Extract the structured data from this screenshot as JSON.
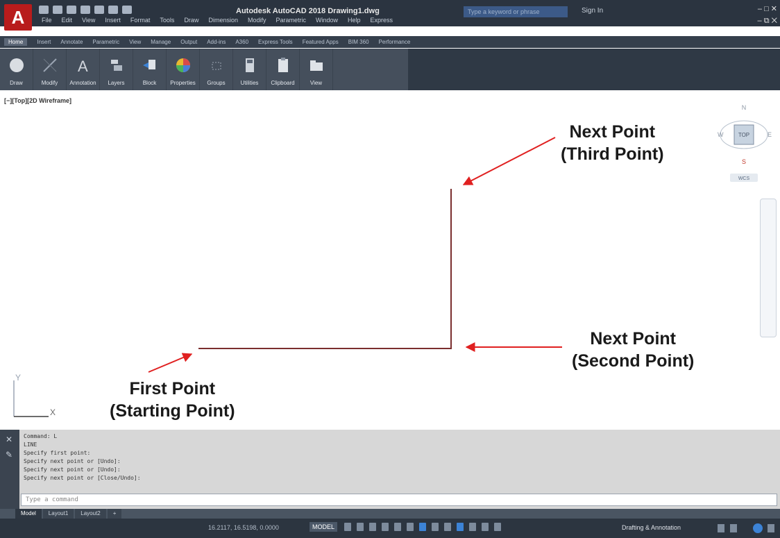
{
  "app": {
    "title": "Autodesk AutoCAD 2018   Drawing1.dwg",
    "search_placeholder": "Type a keyword or phrase",
    "sign_in": "Sign In",
    "logo": "A",
    "window_controls": "– □ ✕",
    "doc_controls": "– ⧉ ✕"
  },
  "menu": [
    "File",
    "Edit",
    "View",
    "Insert",
    "Format",
    "Tools",
    "Draw",
    "Dimension",
    "Modify",
    "Parametric",
    "Window",
    "Help",
    "Express"
  ],
  "ribbon_tabs": [
    "Home",
    "Insert",
    "Annotate",
    "Parametric",
    "View",
    "Manage",
    "Output",
    "Add-ins",
    "A360",
    "Express Tools",
    "Featured Apps",
    "BIM 360",
    "Performance"
  ],
  "ribbon_panels": [
    {
      "label": "Draw",
      "icon": "draw-icon"
    },
    {
      "label": "Modify",
      "icon": "modify-icon"
    },
    {
      "label": "Annotation",
      "icon": "annotation-icon"
    },
    {
      "label": "Layers",
      "icon": "layers-icon"
    },
    {
      "label": "Block",
      "icon": "block-icon"
    },
    {
      "label": "Properties",
      "icon": "properties-icon"
    },
    {
      "label": "Groups",
      "icon": "groups-icon"
    },
    {
      "label": "Utilities",
      "icon": "utilities-icon"
    },
    {
      "label": "Clipboard",
      "icon": "clipboard-icon"
    },
    {
      "label": "View",
      "icon": "view-icon"
    }
  ],
  "viewport": {
    "label": "[−][Top][2D Wireframe]",
    "viewcube": {
      "n": "N",
      "s": "S",
      "e": "E",
      "w": "W",
      "face": "TOP",
      "wcs": "WCS"
    },
    "ucs": {
      "y": "Y",
      "x": "X"
    }
  },
  "callouts": {
    "first_point": {
      "line1": "First Point",
      "line2": "(Starting Point)"
    },
    "second_point": {
      "line1": "Next Point",
      "line2": "(Second Point)"
    },
    "third_point": {
      "line1": "Next Point",
      "line2": "(Third Point)"
    }
  },
  "command": {
    "history": [
      "Command: L",
      "LINE",
      "Specify first point:",
      "Specify next point or [Undo]:",
      "Specify next point or [Undo]:",
      "Specify next point or [Close/Undo]:"
    ],
    "input_placeholder": "Type a command"
  },
  "layout_tabs": [
    "Model",
    "Layout1",
    "Layout2",
    "+"
  ],
  "status": {
    "coords": "16.2117, 16.5198, 0.0000",
    "model": "MODEL",
    "workspace": "Drafting & Annotation"
  },
  "colors": {
    "title_bg": "#2b3440",
    "ribbon_bg": "#454f5c",
    "line": "#7a2e2e",
    "arrow": "#e02020"
  }
}
